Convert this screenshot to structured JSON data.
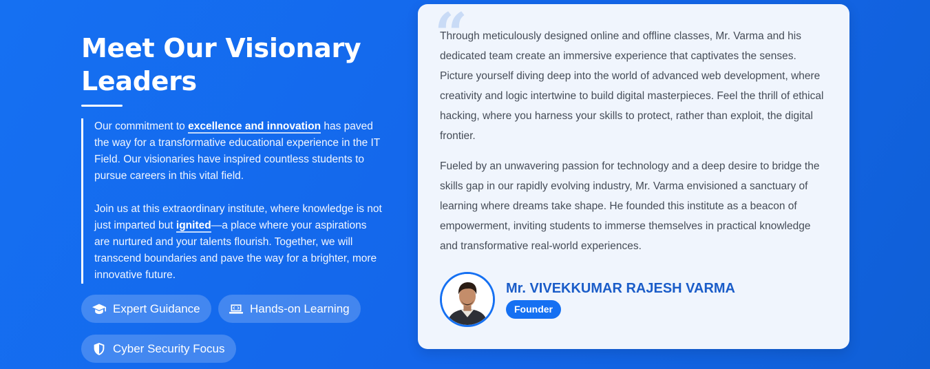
{
  "section": {
    "title_line1": "Meet Our Visionary",
    "title_line2": "Leaders",
    "para1_before": "Our commitment to ",
    "para1_highlight": "excellence and innovation",
    "para1_after": " has paved the way for a transformative educational experience in the IT Field. Our visionaries have inspired countless students to pursue careers in this vital field.",
    "para2_before": "Join us at this extraordinary institute, where knowledge is not just imparted but ",
    "para2_highlight": "ignited",
    "para2_after": "—a place where your aspirations are nurtured and your talents flourish. Together, we will transcend boundaries and pave the way for a brighter, more innovative future."
  },
  "tags": [
    {
      "label": "Expert Guidance",
      "icon": "graduation-cap-icon"
    },
    {
      "label": "Hands-on Learning",
      "icon": "laptop-code-icon"
    },
    {
      "label": "Cyber Security Focus",
      "icon": "shield-icon"
    }
  ],
  "card": {
    "quote_mark": "“",
    "paragraph1": "Through meticulously designed online and offline classes, Mr. Varma and his dedicated team create an immersive experience that captivates the senses. Picture yourself diving deep into the world of advanced web development, where creativity and logic intertwine to build digital masterpieces. Feel the thrill of ethical hacking, where you harness your skills to protect, rather than exploit, the digital frontier.",
    "paragraph2": "Fueled by an unwavering passion for technology and a deep desire to bridge the skills gap in our rapidly evolving industry, Mr. Varma envisioned a sanctuary of learning where dreams take shape. He founded this institute as a beacon of empowerment, inviting students to immerse themselves in practical knowledge and transformative real-world experiences.",
    "name": "Mr. VIVEKKUMAR RAJESH VARMA",
    "role": "Founder"
  },
  "colors": {
    "background": "#1570f2",
    "accent": "#1570f2",
    "card_bg": "#f0f5fd",
    "name_color": "#1a5cc8"
  }
}
